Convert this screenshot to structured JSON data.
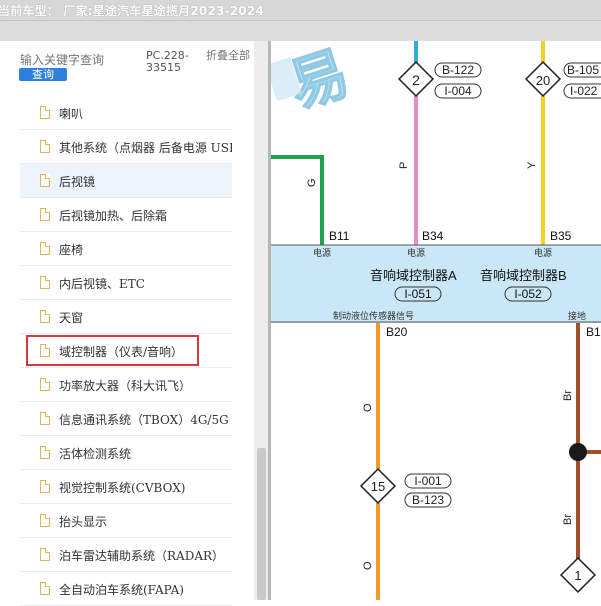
{
  "title": "当前车型：  厂家:星途汽车星途揽月2023-2024",
  "search": {
    "placeholder": "输入关键字查询",
    "button": "查询"
  },
  "pc_label": "PC.228-33515",
  "fold_label": "折叠全部",
  "tree_items": [
    "喇叭",
    "其他系统（点烟器 后备电源 USB充",
    "后视镜",
    "后视镜加热、后除霜",
    "座椅",
    "内后视镜、ETC",
    "天窗",
    "域控制器（仪表/音响）",
    "功率放大器（科大讯飞）",
    "信息通讯系统（TBOX）4G/5G",
    "活体检测系统",
    "视觉控制系统(CVBOX)",
    "抬头显示",
    "泊车雷达辅助系统（RADAR）",
    "全自动泊车系统(FAPA)"
  ],
  "diagram": {
    "watermark": "易",
    "tags": {
      "d1": "2",
      "d2": "20",
      "d3": "15",
      "d4": "1",
      "t1a": "B-122",
      "t1b": "I-004",
      "t2a": "B-105",
      "t2b": "I-022",
      "t3a": "I-001",
      "t3b": "B-123"
    },
    "wires": {
      "g": "G",
      "p": "P",
      "y": "Y",
      "o1": "O",
      "o2": "O",
      "br1": "Br",
      "br2": "Br"
    },
    "pins": {
      "b11": "B11",
      "b34": "B34",
      "b35": "B35",
      "b20": "B20",
      "b1": "B1"
    },
    "power_labels": [
      "电源",
      "电源",
      "电源"
    ],
    "module_a": "音响域控制器A",
    "module_b": "音响域控制器B",
    "code_a": "I-051",
    "code_b": "I-052",
    "brake_signal": "制动液位传感器信号",
    "ground": "接地"
  }
}
